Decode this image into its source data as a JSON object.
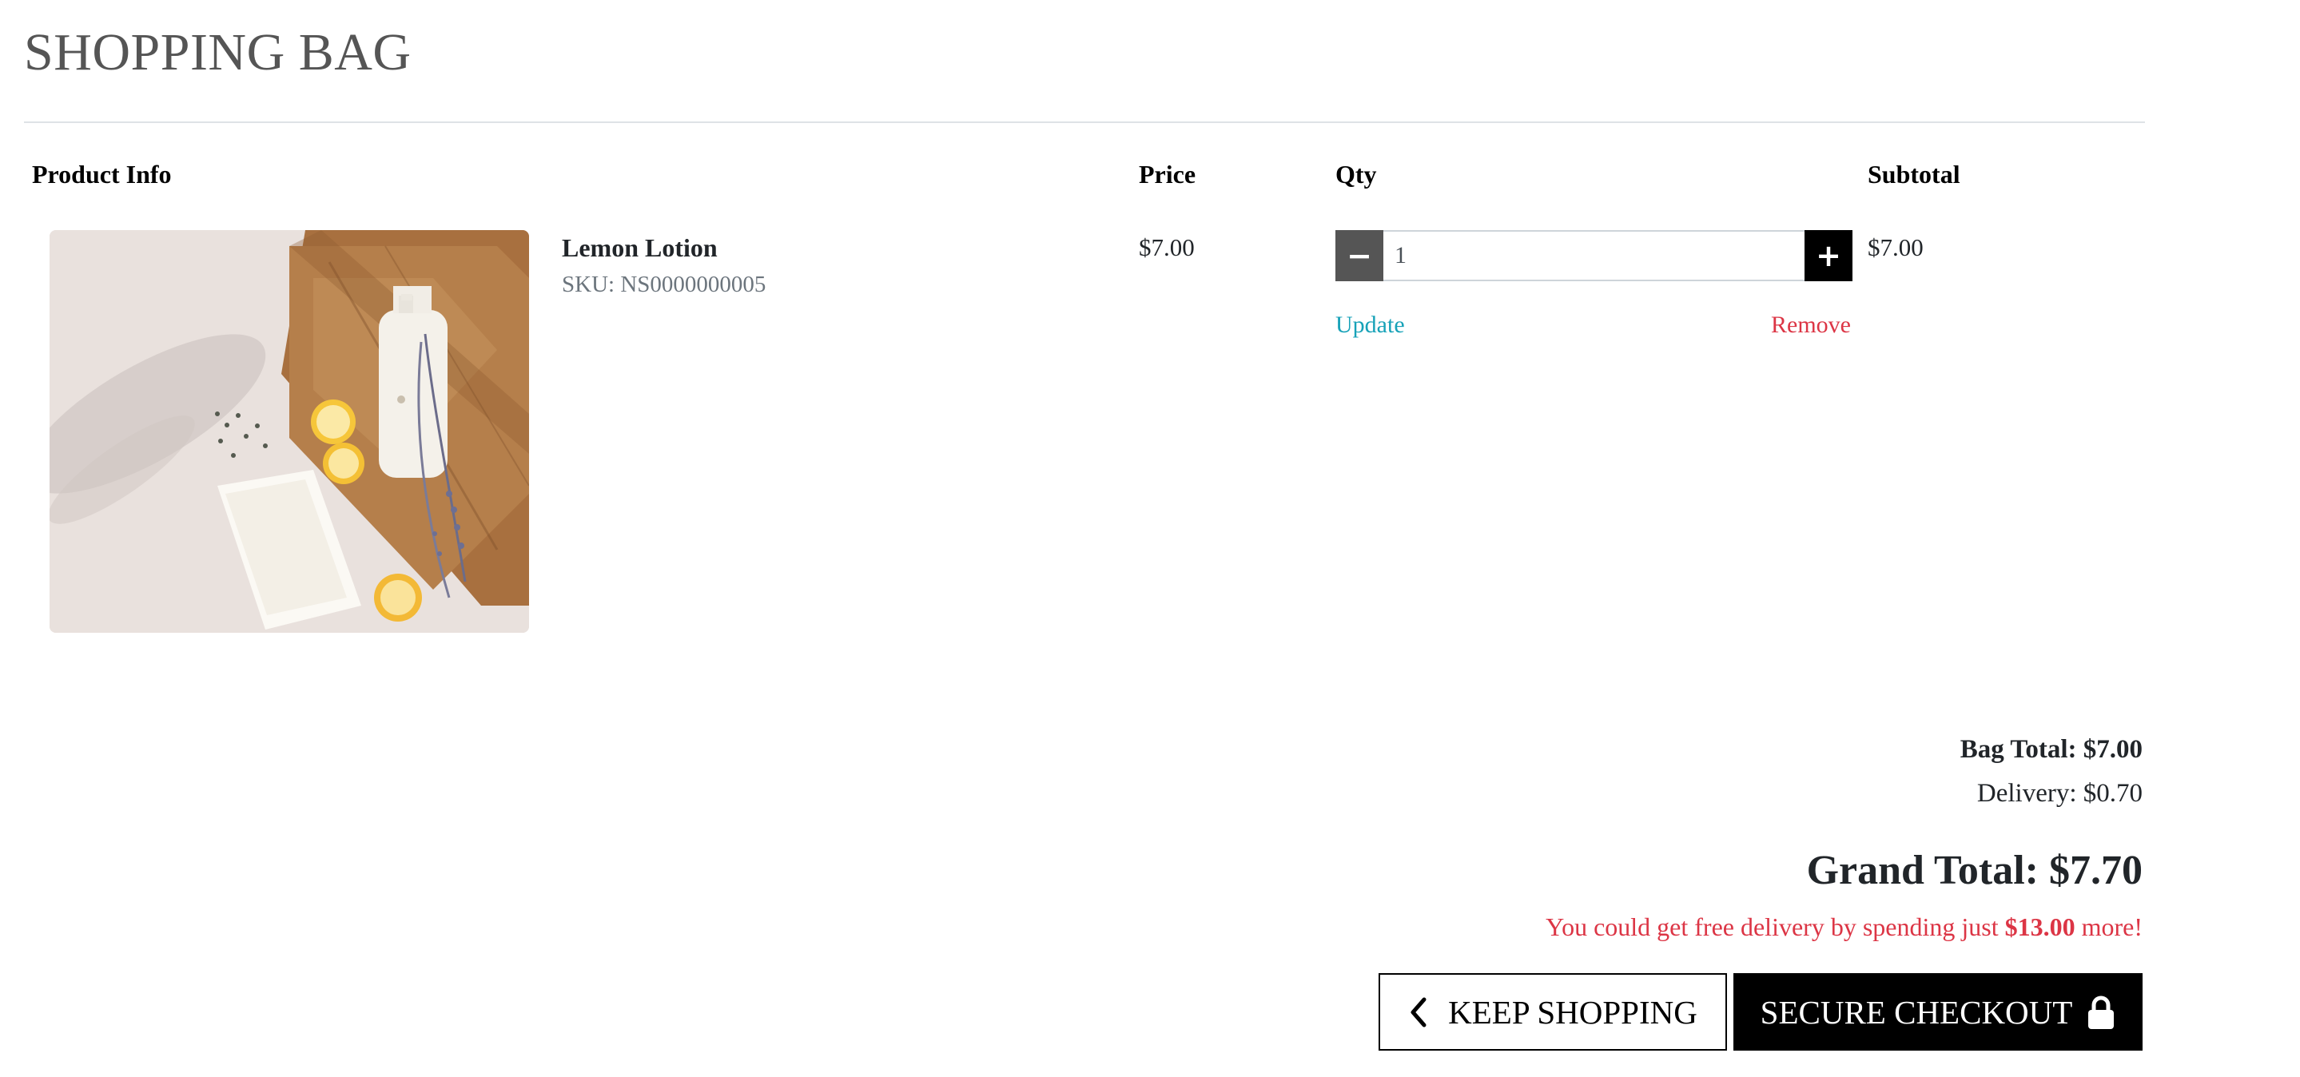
{
  "page": {
    "title": "SHOPPING BAG"
  },
  "table": {
    "headers": {
      "product": "Product Info",
      "price": "Price",
      "qty": "Qty",
      "subtotal": "Subtotal"
    },
    "items": [
      {
        "name": "Lemon Lotion",
        "sku": "SKU: NS0000000005",
        "price": "$7.00",
        "quantity": "1",
        "subtotal": "$7.00",
        "update_label": "Update",
        "remove_label": "Remove",
        "decrease_icon": "minus-icon",
        "increase_icon": "plus-icon"
      }
    ]
  },
  "summary": {
    "bag_total": "Bag Total: $7.00",
    "delivery": "Delivery: $0.70",
    "grand_total": "Grand Total: $7.70",
    "free_delivery_prefix": "You could get free delivery by spending just",
    "free_delivery_amount": "$13.00",
    "free_delivery_suffix": "more!"
  },
  "actions": {
    "keep_shopping": "KEEP SHOPPING",
    "keep_shopping_icon": "chevron-left-icon",
    "secure_checkout": "SECURE CHECKOUT",
    "secure_checkout_icon": "lock-icon"
  },
  "colors": {
    "title": "#555555",
    "link_update": "#17a2b8",
    "link_remove": "#dc3545",
    "free_delivery": "#dc3545",
    "checkout_bg": "#000000",
    "minus_bg": "#555555",
    "plus_bg": "#000000"
  }
}
